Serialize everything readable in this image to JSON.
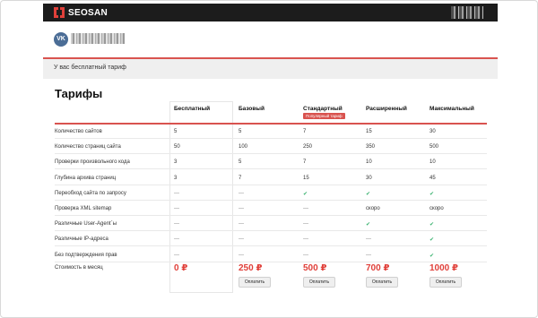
{
  "header": {
    "logo_text": "SEOSAN"
  },
  "user": {
    "avatar_text": "VK"
  },
  "tariff_notice": "У вас бесплатный тариф",
  "page_title": "Тарифы",
  "plans": [
    {
      "name": "Бесплатный",
      "price": "0 ₽",
      "button": ""
    },
    {
      "name": "Базовый",
      "price": "250 ₽",
      "button": "Оплатить"
    },
    {
      "name": "Стандартный",
      "price": "500 ₽",
      "button": "Оплатить",
      "badge": "Популярный тариф"
    },
    {
      "name": "Расширенный",
      "price": "700 ₽",
      "button": "Оплатить"
    },
    {
      "name": "Максимальный",
      "price": "1000 ₽",
      "button": "Оплатить"
    }
  ],
  "features": [
    {
      "label": "Количество сайтов",
      "values": [
        "5",
        "5",
        "7",
        "15",
        "30"
      ]
    },
    {
      "label": "Количество страниц сайта",
      "values": [
        "50",
        "100",
        "250",
        "350",
        "500"
      ]
    },
    {
      "label": "Проверки произвольного кода",
      "values": [
        "3",
        "5",
        "7",
        "10",
        "10"
      ]
    },
    {
      "label": "Глубина архива страниц",
      "values": [
        "3",
        "7",
        "15",
        "30",
        "45"
      ]
    },
    {
      "label": "Переобход сайта по запросу",
      "values": [
        "—",
        "—",
        "✔",
        "✔",
        "✔"
      ]
    },
    {
      "label": "Проверка XML sitemap",
      "values": [
        "—",
        "—",
        "—",
        "скоро",
        "скоро"
      ]
    },
    {
      "label": "Различные User-Agent`ы",
      "values": [
        "—",
        "—",
        "—",
        "✔",
        "✔"
      ]
    },
    {
      "label": "Различные IP-адреса",
      "values": [
        "—",
        "—",
        "—",
        "—",
        "✔"
      ]
    },
    {
      "label": "Без подтверждения прав",
      "values": [
        "—",
        "—",
        "—",
        "—",
        "✔"
      ]
    }
  ],
  "price_label": "Стоимость в месяц",
  "colors": {
    "accent": "#d9534f",
    "topbar": "#1c1c1c",
    "check": "#3cb371"
  }
}
